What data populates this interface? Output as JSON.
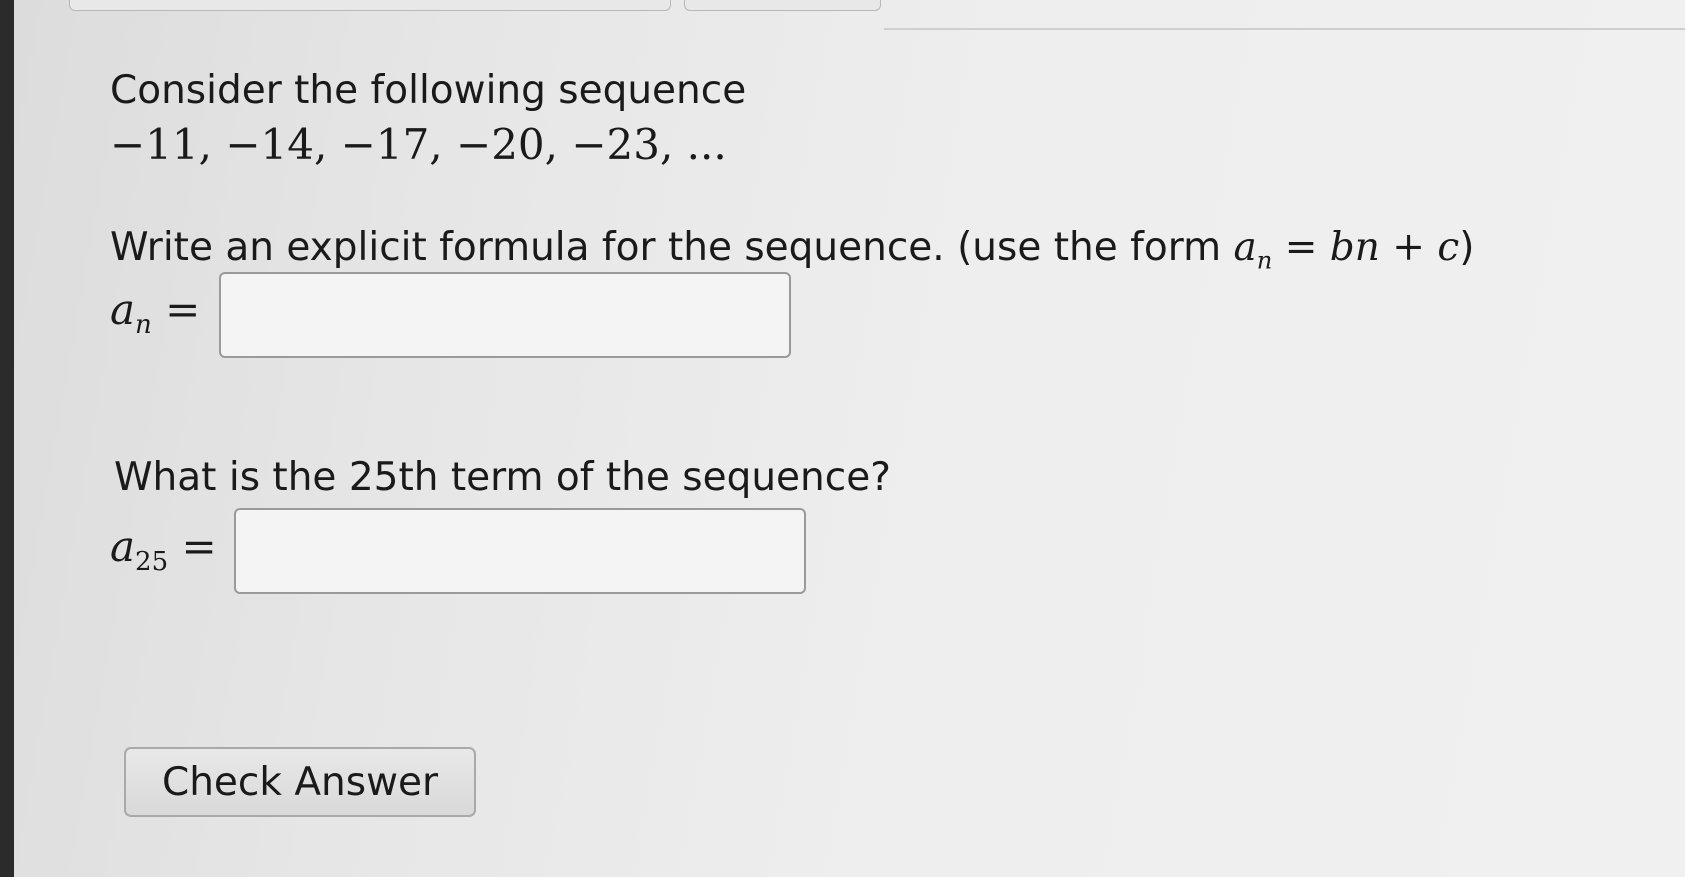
{
  "question": {
    "intro": "Consider the following sequence",
    "sequence": "−11, −14, −17, −20, −23, ...",
    "part1_prompt": "Write an explicit formula for the sequence. (use the form ",
    "form_lhs_var": "a",
    "form_lhs_sub": "n",
    "form_rhs": " = bn + c",
    "form_close": ")",
    "answer1_label_var": "a",
    "answer1_label_sub": "n",
    "answer1_label_eq": "=",
    "answer1_value": "",
    "part2_prompt": "What is the 25th term of the sequence?",
    "answer2_label_var": "a",
    "answer2_label_sub": "25",
    "answer2_label_eq": "=",
    "answer2_value": ""
  },
  "actions": {
    "check_answer_label": "Check Answer"
  }
}
